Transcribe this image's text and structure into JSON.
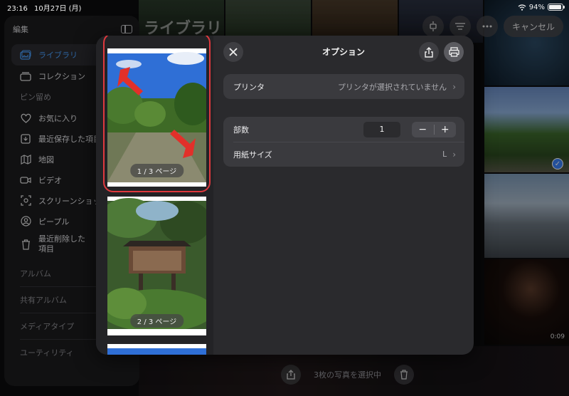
{
  "status_bar": {
    "time": "23:16",
    "date": "10月27日 (月)",
    "battery": "94%",
    "battery_level": 0.94
  },
  "library": {
    "title": "ライブラリ",
    "cancel_label": "キャンセル",
    "video_duration": "0:09",
    "selection_text": "3枚の写真を選択中"
  },
  "sidebar": {
    "edit_label": "編集",
    "items_top": [
      {
        "label": "ライブラリ",
        "icon": "photos-icon",
        "active": true
      },
      {
        "label": "コレクション",
        "icon": "collection-icon"
      }
    ],
    "pinned_header": "ピン留め",
    "pinned_items": [
      {
        "label": "お気に入り",
        "icon": "heart-icon"
      },
      {
        "label": "最近保存した項目",
        "icon": "recent-saved-icon"
      },
      {
        "label": "地図",
        "icon": "map-icon"
      },
      {
        "label": "ビデオ",
        "icon": "video-icon"
      },
      {
        "label": "スクリーンショット",
        "icon": "screenshot-icon"
      },
      {
        "label": "ピープル",
        "icon": "person-icon"
      },
      {
        "label": "最近削除した項目",
        "icon": "trash-icon"
      }
    ],
    "sections": [
      "アルバム",
      "共有アルバム",
      "メディアタイプ",
      "ユーティリティ"
    ]
  },
  "print": {
    "title": "オプション",
    "pages": [
      {
        "label": "1 / 3 ページ"
      },
      {
        "label": "2 / 3 ページ"
      }
    ],
    "printer": {
      "label": "プリンタ",
      "value": "プリンタが選択されていません"
    },
    "copies": {
      "label": "部数",
      "value": "1",
      "minus": "−",
      "plus": "+"
    },
    "paper": {
      "label": "用紙サイズ",
      "value": "L"
    }
  }
}
